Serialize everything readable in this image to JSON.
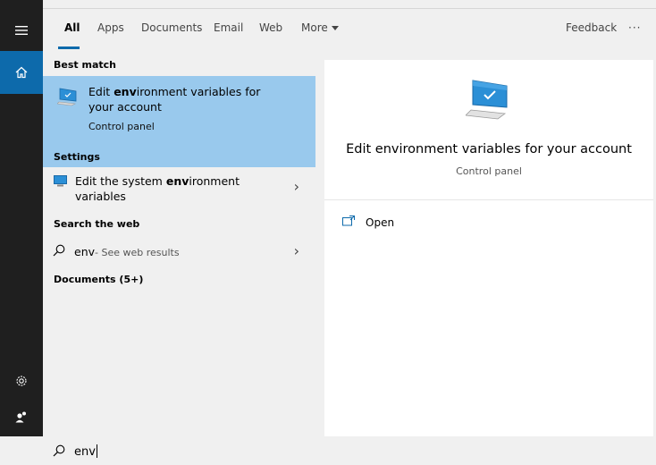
{
  "colors": {
    "rail_bg": "#1f1f1f",
    "accent": "#0d6aab",
    "selection_bg": "#99c9ed",
    "panel_bg": "#f0f0f0",
    "preview_bg": "#ffffff"
  },
  "rail": {
    "items": [
      {
        "icon": "hamburger-menu-icon"
      },
      {
        "icon": "home-icon",
        "active": true
      },
      {
        "icon": "gear-icon"
      },
      {
        "icon": "user-switch-icon"
      }
    ]
  },
  "tabs": {
    "items": [
      {
        "label": "All",
        "active": true
      },
      {
        "label": "Apps"
      },
      {
        "label": "Documents"
      },
      {
        "label": "Email"
      },
      {
        "label": "Web"
      },
      {
        "label": "More"
      }
    ],
    "feedback": "Feedback",
    "more_options": "···"
  },
  "results": {
    "best_match_header": "Best match",
    "best_match": {
      "title_prefix": "Edit ",
      "title_bold": "env",
      "title_suffix": "ironment variables for",
      "title_line2": "your account",
      "subtitle": "Control panel"
    },
    "settings_header": "Settings",
    "settings_item": {
      "title_prefix": "Edit the system ",
      "title_bold": "env",
      "title_suffix": "ironment",
      "title_line2": "variables"
    },
    "web_header": "Search the web",
    "web_item": {
      "query": "env",
      "suffix": " - See web results"
    },
    "documents_header": "Documents (5+)"
  },
  "preview": {
    "title": "Edit environment variables for your account",
    "subtitle": "Control panel",
    "open_label": "Open"
  },
  "search": {
    "value": "env"
  }
}
